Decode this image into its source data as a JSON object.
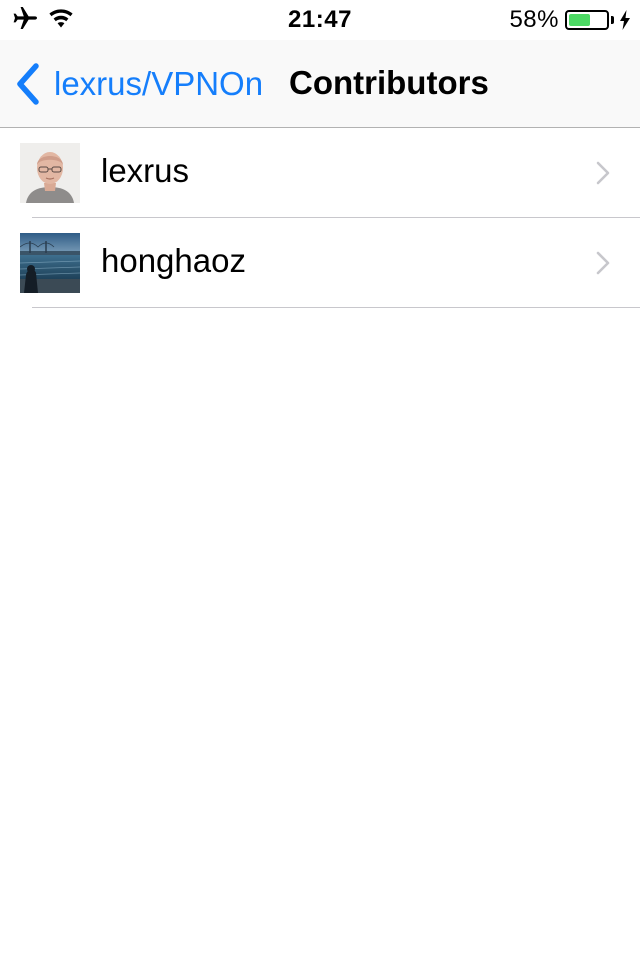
{
  "status_bar": {
    "time": "21:47",
    "battery_percent": "58%",
    "battery_level": 0.58,
    "icons": [
      "airplane-icon",
      "wifi-icon",
      "battery-icon",
      "charging-bolt-icon"
    ]
  },
  "nav": {
    "back_label": "lexrus/VPNOn",
    "title": "Contributors",
    "accent_color": "#157efb"
  },
  "contributors": [
    {
      "name": "lexrus"
    },
    {
      "name": "honghaoz"
    }
  ]
}
